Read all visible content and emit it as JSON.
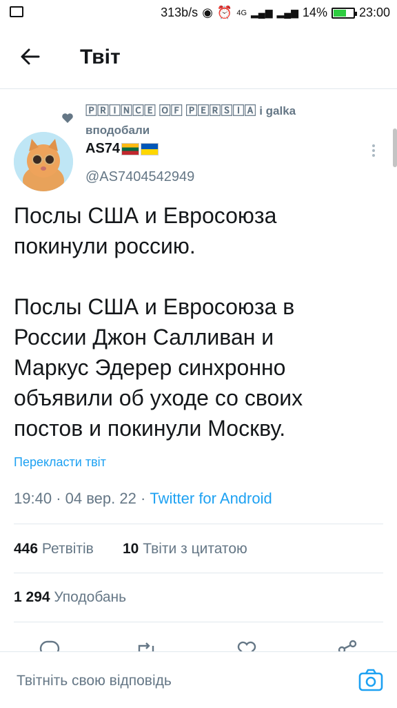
{
  "status_bar": {
    "speed": "313b/s",
    "network": "4G",
    "battery": "14%",
    "time": "23:00"
  },
  "header": {
    "title": "Твіт"
  },
  "tweet": {
    "liked_by_1": "🄿🅁🄸🄽🄲🄴 🄾🄵 🄿🄴🅁🅂🄸🄰",
    "liked_by_2": "i galka",
    "liked_suffix": "вподобали",
    "author_name": "AS74",
    "author_handle": "@AS7404542949",
    "text": "Послы США и Евросоюза\nпокинули россию.\n\nПослы США и Евросоюза в\nРоссии Джон Салливан и\nМаркус Эдерер синхронно\nобъявили об уходе со своих\nпостов и покинули Москву.",
    "translate_label": "Перекласти твіт",
    "time": "19:40",
    "date": "04 вер. 22",
    "source": "Twitter for Android",
    "retweets_count": "446",
    "retweets_label": "Ретвітів",
    "quotes_count": "10",
    "quotes_label": "Твіти з цитатою",
    "likes_count": "1 294",
    "likes_label": "Уподобань"
  },
  "reply": {
    "placeholder": "Твітніть свою відповідь"
  },
  "colors": {
    "accent": "#1da1f2",
    "muted": "#657786",
    "divider": "#e1e8ed"
  }
}
